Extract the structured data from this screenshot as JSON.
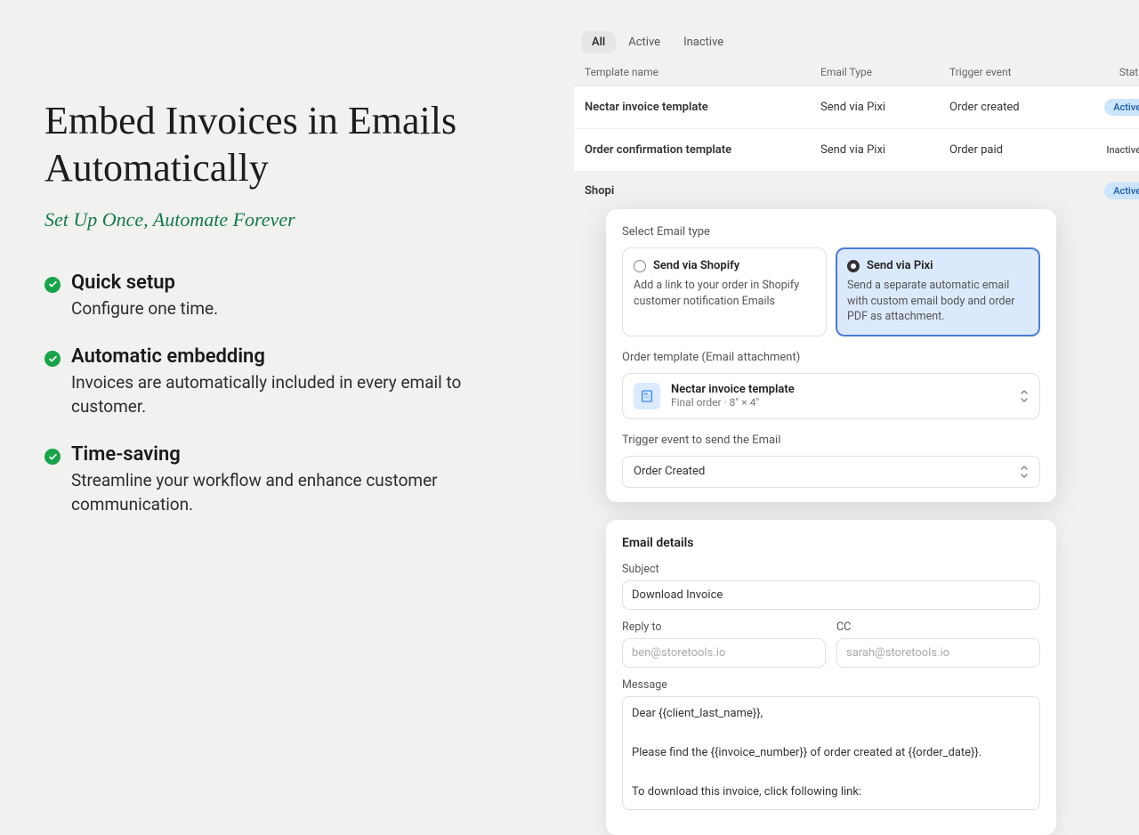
{
  "marketing": {
    "headline": "Embed Invoices in Emails Automatically",
    "subhead": "Set Up Once, Automate Forever",
    "features": [
      {
        "title": "Quick setup",
        "desc": "Configure one time."
      },
      {
        "title": "Automatic embedding",
        "desc": "Invoices are automatically included in every email to customer."
      },
      {
        "title": "Time-saving",
        "desc": "Streamline your workflow and enhance customer communication."
      }
    ]
  },
  "tabs": [
    "All",
    "Active",
    "Inactive"
  ],
  "columns": {
    "name": "Template name",
    "type": "Email Type",
    "trigger": "Trigger event",
    "status": "Status"
  },
  "rows": [
    {
      "name": "Nectar invoice template",
      "type": "Send via Pixi",
      "trigger": "Order created",
      "status": "Active"
    },
    {
      "name": "Order confirmation template",
      "type": "Send via Pixi",
      "trigger": "Order paid",
      "status": "Inactive"
    },
    {
      "name": "Shopi",
      "type": "",
      "trigger": "",
      "status": "Active"
    }
  ],
  "config": {
    "select_email_type": "Select Email type",
    "option_shopify": {
      "title": "Send via Shopify",
      "desc": "Add a link to your order in Shopify customer notification Emails"
    },
    "option_pixi": {
      "title": "Send via Pixi",
      "desc": "Send a separate automatic email with custom email body and order PDF as attachment."
    },
    "order_template_label": "Order template (Email attachment)",
    "template": {
      "name": "Nectar invoice template",
      "sub": "Final order  ·  8″ × 4″"
    },
    "trigger_label": "Trigger event to send the Email",
    "trigger_value": "Order Created"
  },
  "email": {
    "section": "Email details",
    "subject_label": "Subject",
    "subject_value": "Download Invoice",
    "reply_to_label": "Reply to",
    "reply_to_placeholder": "ben@storetools.io",
    "cc_label": "CC",
    "cc_placeholder": "sarah@storetools.io",
    "message_label": "Message",
    "message_value": "Dear {{client_last_name}},\n\nPlease find the {{invoice_number}} of order created at {{order_date}}.\n\nTo download this invoice, click following link:"
  }
}
